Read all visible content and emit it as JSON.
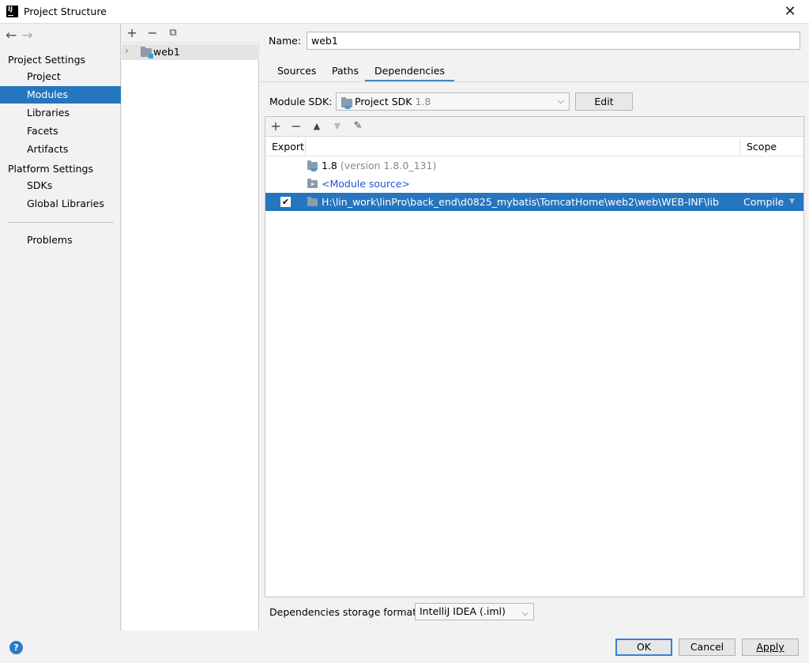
{
  "window": {
    "title": "Project Structure",
    "app_icon": "IJ"
  },
  "nav": {
    "project_settings": "Project Settings",
    "items_project": [
      "Project",
      "Modules",
      "Libraries",
      "Facets",
      "Artifacts"
    ],
    "platform_settings": "Platform Settings",
    "items_platform": [
      "SDKs",
      "Global Libraries"
    ],
    "problems": "Problems",
    "active": "Modules"
  },
  "modules": {
    "list": [
      "web1"
    ]
  },
  "module": {
    "name_label": "Name:",
    "name_value": "web1",
    "tabs": [
      "Sources",
      "Paths",
      "Dependencies"
    ],
    "active_tab": "Dependencies",
    "sdk_label": "Module SDK:",
    "sdk_name": "Project SDK",
    "sdk_version": "1.8",
    "edit_button": "Edit"
  },
  "dependencies": {
    "columns": {
      "export": "Export",
      "scope": "Scope"
    },
    "rows": [
      {
        "name": "1.8",
        "detail": "(version 1.8.0_131)",
        "exported": false,
        "scope": ""
      },
      {
        "name": "<Module source>",
        "detail": "",
        "exported": false,
        "scope": ""
      },
      {
        "name": "H:\\lin_work\\linPro\\back_end\\d0825_mybatis\\TomcatHome\\web2\\web\\WEB-INF\\lib",
        "detail": "",
        "exported": true,
        "scope": "Compile",
        "selected": true
      }
    ]
  },
  "storage": {
    "label": "Dependencies storage format:",
    "value": "IntelliJ IDEA (.iml)"
  },
  "footer": {
    "ok": "OK",
    "cancel": "Cancel",
    "apply": "Apply",
    "help": "?"
  },
  "colors": {
    "selection": "#2675bf",
    "tab_underline": "#4083c9",
    "link": "#2155c8"
  }
}
